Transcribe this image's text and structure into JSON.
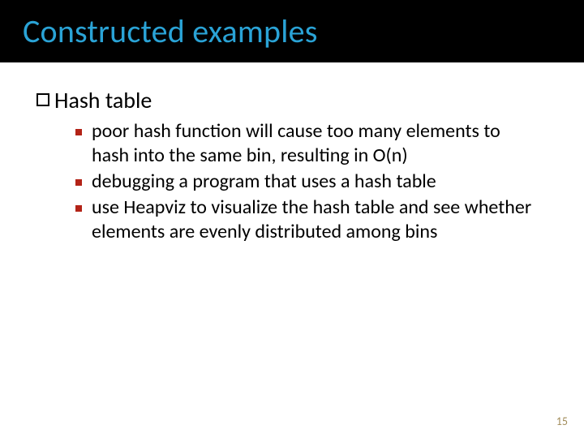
{
  "title": "Constructed examples",
  "section": {
    "heading": "Hash table",
    "items": [
      "poor hash function will cause too many elements to hash into the same bin, resulting in O(n)",
      "debugging a program that uses a hash table",
      "use Heapviz to visualize the hash table and see whether elements are evenly distributed among bins"
    ]
  },
  "page_number": "15"
}
